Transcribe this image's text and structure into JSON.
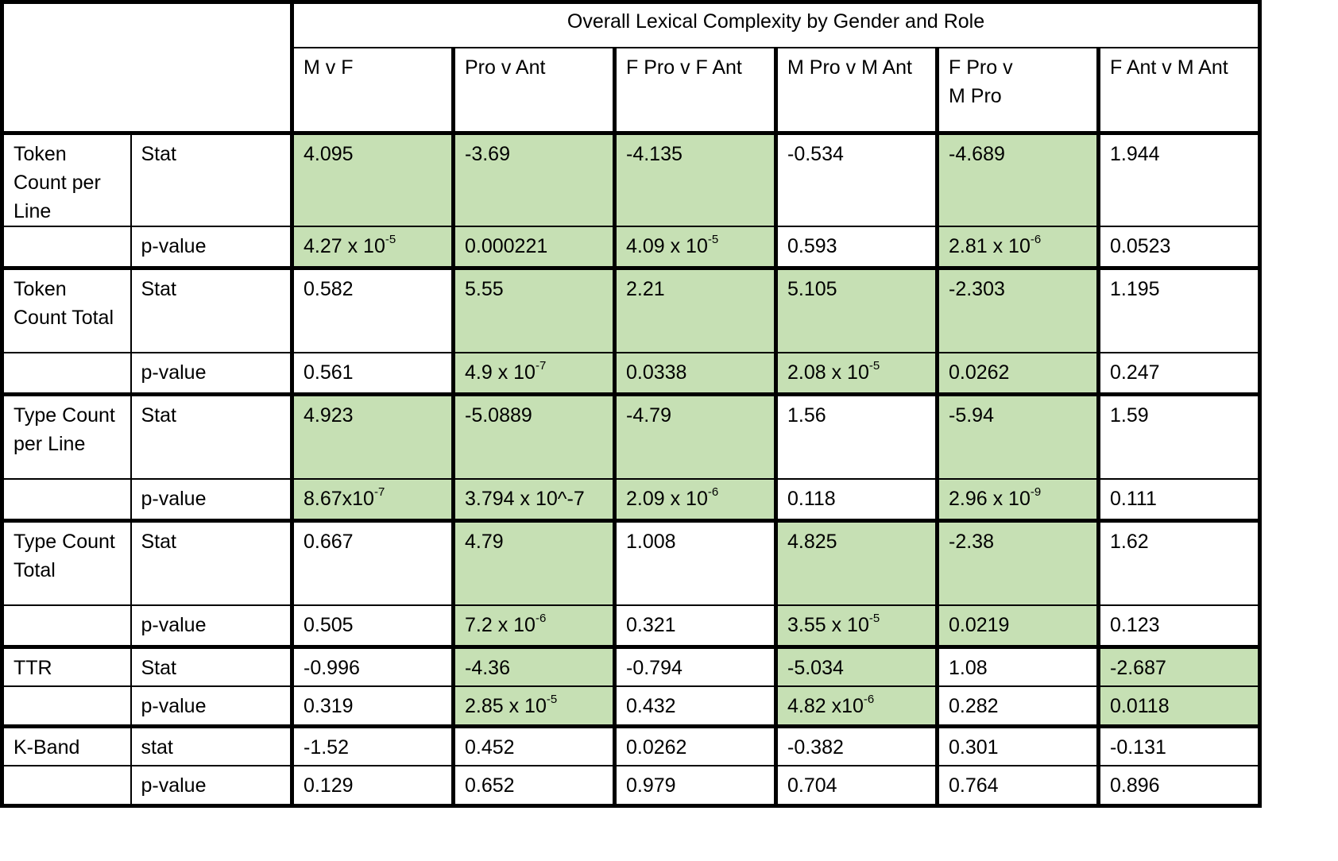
{
  "title": "Overall Lexical Complexity by Gender and Role",
  "columns": [
    "M v F",
    "Pro v Ant",
    "F Pro v F Ant",
    "M Pro v M Ant",
    "F Pro v\nM Pro",
    "F Ant v M Ant"
  ],
  "colors": {
    "significant_fill": "#c6e0b4",
    "border": "#000000"
  },
  "rows": [
    {
      "metric": "Token Count per Line",
      "stat_label": "Stat",
      "stat": [
        {
          "v": "4.095",
          "sig": true
        },
        {
          "v": "-3.69",
          "sig": true
        },
        {
          "v": "-4.135",
          "sig": true
        },
        {
          "v": "-0.534",
          "sig": false
        },
        {
          "v": "-4.689",
          "sig": true
        },
        {
          "v": "1.944",
          "sig": false
        }
      ],
      "p_label": "p-value",
      "p": [
        {
          "v": "4.27 x 10",
          "exp": "-5",
          "sig": true
        },
        {
          "v": "0.000221",
          "sig": true
        },
        {
          "v": "4.09 x 10",
          "exp": "-5",
          "sig": true
        },
        {
          "v": "0.593",
          "sig": false
        },
        {
          "v": "2.81 x 10",
          "exp": "-6",
          "sig": true
        },
        {
          "v": "0.0523",
          "sig": false
        }
      ]
    },
    {
      "metric": "Token Count Total",
      "stat_label": "Stat",
      "stat": [
        {
          "v": "0.582",
          "sig": false
        },
        {
          "v": "5.55",
          "sig": true
        },
        {
          "v": "2.21",
          "sig": true
        },
        {
          "v": "5.105",
          "sig": true
        },
        {
          "v": "-2.303",
          "sig": true
        },
        {
          "v": "1.195",
          "sig": false
        }
      ],
      "p_label": "p-value",
      "p": [
        {
          "v": "0.561",
          "sig": false
        },
        {
          "v": "4.9 x 10",
          "exp": "-7",
          "sig": true
        },
        {
          "v": "0.0338",
          "sig": true
        },
        {
          "v": "2.08 x 10",
          "exp": "-5",
          "sig": true
        },
        {
          "v": "0.0262",
          "sig": true
        },
        {
          "v": "0.247",
          "sig": false
        }
      ]
    },
    {
      "metric": "Type Count per Line",
      "stat_label": "Stat",
      "stat": [
        {
          "v": "4.923",
          "sig": true
        },
        {
          "v": "-5.0889",
          "sig": true
        },
        {
          "v": "-4.79",
          "sig": true
        },
        {
          "v": "1.56",
          "sig": false
        },
        {
          "v": "-5.94",
          "sig": true
        },
        {
          "v": "1.59",
          "sig": false
        }
      ],
      "p_label": "p-value",
      "p": [
        {
          "v": "8.67x10",
          "exp": "-7",
          "sig": true
        },
        {
          "v": "3.794 x 10^-7",
          "sig": true
        },
        {
          "v": "2.09 x 10",
          "exp": "-6",
          "sig": true
        },
        {
          "v": "0.118",
          "sig": false
        },
        {
          "v": "2.96 x 10",
          "exp": "-9",
          "sig": true
        },
        {
          "v": "0.111",
          "sig": false
        }
      ]
    },
    {
      "metric": "Type Count Total",
      "stat_label": "Stat",
      "stat": [
        {
          "v": "0.667",
          "sig": false
        },
        {
          "v": "4.79",
          "sig": true
        },
        {
          "v": "1.008",
          "sig": false
        },
        {
          "v": "4.825",
          "sig": true
        },
        {
          "v": "-2.38",
          "sig": true
        },
        {
          "v": "1.62",
          "sig": false
        }
      ],
      "p_label": "p-value",
      "p": [
        {
          "v": "0.505",
          "sig": false
        },
        {
          "v": "7.2 x 10",
          "exp": "-6",
          "sig": true
        },
        {
          "v": "0.321",
          "sig": false
        },
        {
          "v": "3.55 x 10",
          "exp": "-5",
          "sig": true
        },
        {
          "v": "0.0219",
          "sig": true
        },
        {
          "v": "0.123",
          "sig": false
        }
      ]
    },
    {
      "metric": "TTR",
      "stat_label": "Stat",
      "stat": [
        {
          "v": "-0.996",
          "sig": false
        },
        {
          "v": "-4.36",
          "sig": true
        },
        {
          "v": "-0.794",
          "sig": false
        },
        {
          "v": "-5.034",
          "sig": true
        },
        {
          "v": "1.08",
          "sig": false
        },
        {
          "v": "-2.687",
          "sig": true
        }
      ],
      "p_label": "p-value",
      "p": [
        {
          "v": "0.319",
          "sig": false
        },
        {
          "v": "2.85 x 10",
          "exp": "-5",
          "sig": true
        },
        {
          "v": "0.432",
          "sig": false
        },
        {
          "v": "4.82 x10",
          "exp": "-6",
          "sig": true
        },
        {
          "v": "0.282",
          "sig": false
        },
        {
          "v": "0.0118",
          "sig": true
        }
      ]
    },
    {
      "metric": "K-Band",
      "stat_label": "stat",
      "stat": [
        {
          "v": "-1.52",
          "sig": false
        },
        {
          "v": "0.452",
          "sig": false
        },
        {
          "v": "0.0262",
          "sig": false
        },
        {
          "v": "-0.382",
          "sig": false
        },
        {
          "v": "0.301",
          "sig": false
        },
        {
          "v": "-0.131",
          "sig": false
        }
      ],
      "p_label": "p-value",
      "p": [
        {
          "v": "0.129",
          "sig": false
        },
        {
          "v": "0.652",
          "sig": false
        },
        {
          "v": "0.979",
          "sig": false
        },
        {
          "v": "0.704",
          "sig": false
        },
        {
          "v": "0.764",
          "sig": false
        },
        {
          "v": "0.896",
          "sig": false
        }
      ]
    }
  ]
}
